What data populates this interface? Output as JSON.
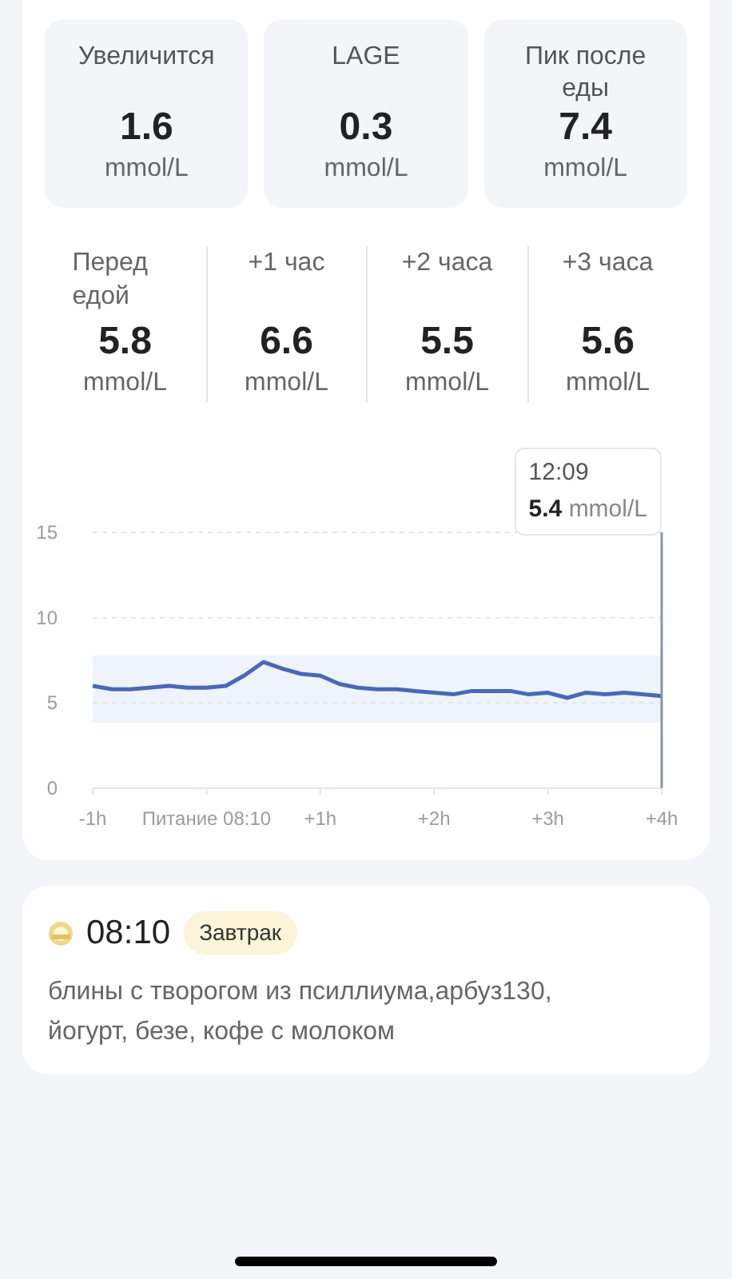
{
  "stats": [
    {
      "label": "Увеличится",
      "value": "1.6",
      "unit": "mmol/L"
    },
    {
      "label": "LAGE",
      "value": "0.3",
      "unit": "mmol/L"
    },
    {
      "label": "Пик после еды",
      "value": "7.4",
      "unit": "mmol/L"
    }
  ],
  "intervals": [
    {
      "label": "Перед едой",
      "value": "5.8",
      "unit": "mmol/L"
    },
    {
      "label": "+1 час",
      "value": "6.6",
      "unit": "mmol/L"
    },
    {
      "label": "+2 часа",
      "value": "5.5",
      "unit": "mmol/L"
    },
    {
      "label": "+3 часа",
      "value": "5.6",
      "unit": "mmol/L"
    }
  ],
  "tooltip": {
    "time": "12:09",
    "value": "5.4",
    "unit": "mmol/L"
  },
  "chart_data": {
    "type": "line",
    "ylim": [
      0,
      15
    ],
    "xlim": [
      -1,
      4
    ],
    "yticks": [
      0,
      5,
      10,
      15
    ],
    "xticks": [
      {
        "value": -1,
        "label": "-1h"
      },
      {
        "value": 0,
        "label": "Питание 08:10"
      },
      {
        "value": 1,
        "label": "+1h"
      },
      {
        "value": 2,
        "label": "+2h"
      },
      {
        "value": 3,
        "label": "+3h"
      },
      {
        "value": 4,
        "label": "+4h"
      }
    ],
    "x": [
      -1,
      -0.83,
      -0.67,
      -0.5,
      -0.33,
      -0.17,
      0,
      0.17,
      0.33,
      0.5,
      0.67,
      0.83,
      1,
      1.17,
      1.33,
      1.5,
      1.67,
      1.83,
      2,
      2.17,
      2.33,
      2.5,
      2.67,
      2.83,
      3,
      3.17,
      3.33,
      3.5,
      3.67,
      3.83,
      4
    ],
    "series": [
      {
        "color": "#4a67b8",
        "values": [
          6.0,
          5.8,
          5.8,
          5.9,
          6.0,
          5.9,
          5.9,
          6.0,
          6.6,
          7.4,
          7.0,
          6.7,
          6.6,
          6.1,
          5.9,
          5.8,
          5.8,
          5.7,
          5.6,
          5.5,
          5.7,
          5.7,
          5.7,
          5.5,
          5.6,
          5.3,
          5.6,
          5.5,
          5.6,
          5.5,
          5.4
        ]
      }
    ]
  },
  "meal": {
    "time": "08:10",
    "tag": "Завтрак",
    "description": "блины с творогом из псиллиума,арбуз130, йогурт, безе, кофе с молоком"
  }
}
